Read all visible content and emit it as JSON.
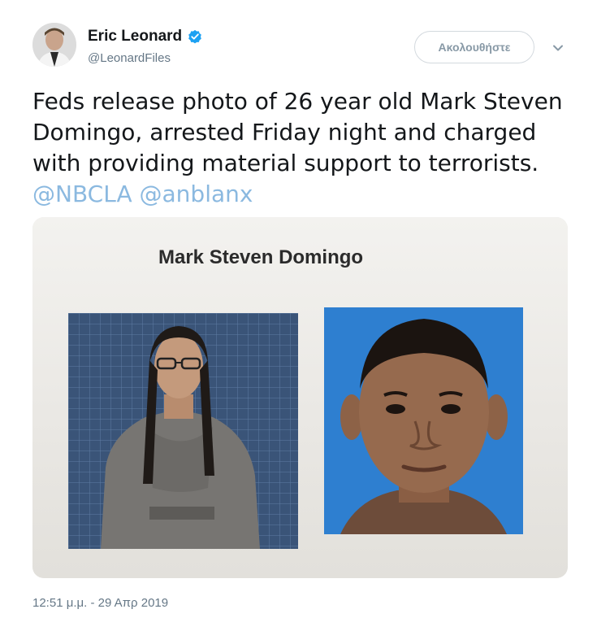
{
  "user": {
    "display_name": "Eric Leonard",
    "handle": "@LeonardFiles",
    "verified": true,
    "avatar_icon": "profile-photo"
  },
  "actions": {
    "follow_label": "Ακολουθήστε",
    "more_icon": "chevron-down-icon"
  },
  "tweet": {
    "text": "Feds release photo of 26 year old Mark Steven Domingo, arrested Friday night and charged with providing material support to terrorists.",
    "mentions": [
      "@NBCLA",
      "@anblanx"
    ]
  },
  "media": {
    "document_title": "Mark Steven Domingo"
  },
  "timestamp": "12:51 μ.μ. - 29 Απρ 2019",
  "colors": {
    "link": "#8bb9e0",
    "verified": "#1da1f2",
    "secondary_text": "#657786",
    "photo_right_bg": "#2e7fd0"
  }
}
